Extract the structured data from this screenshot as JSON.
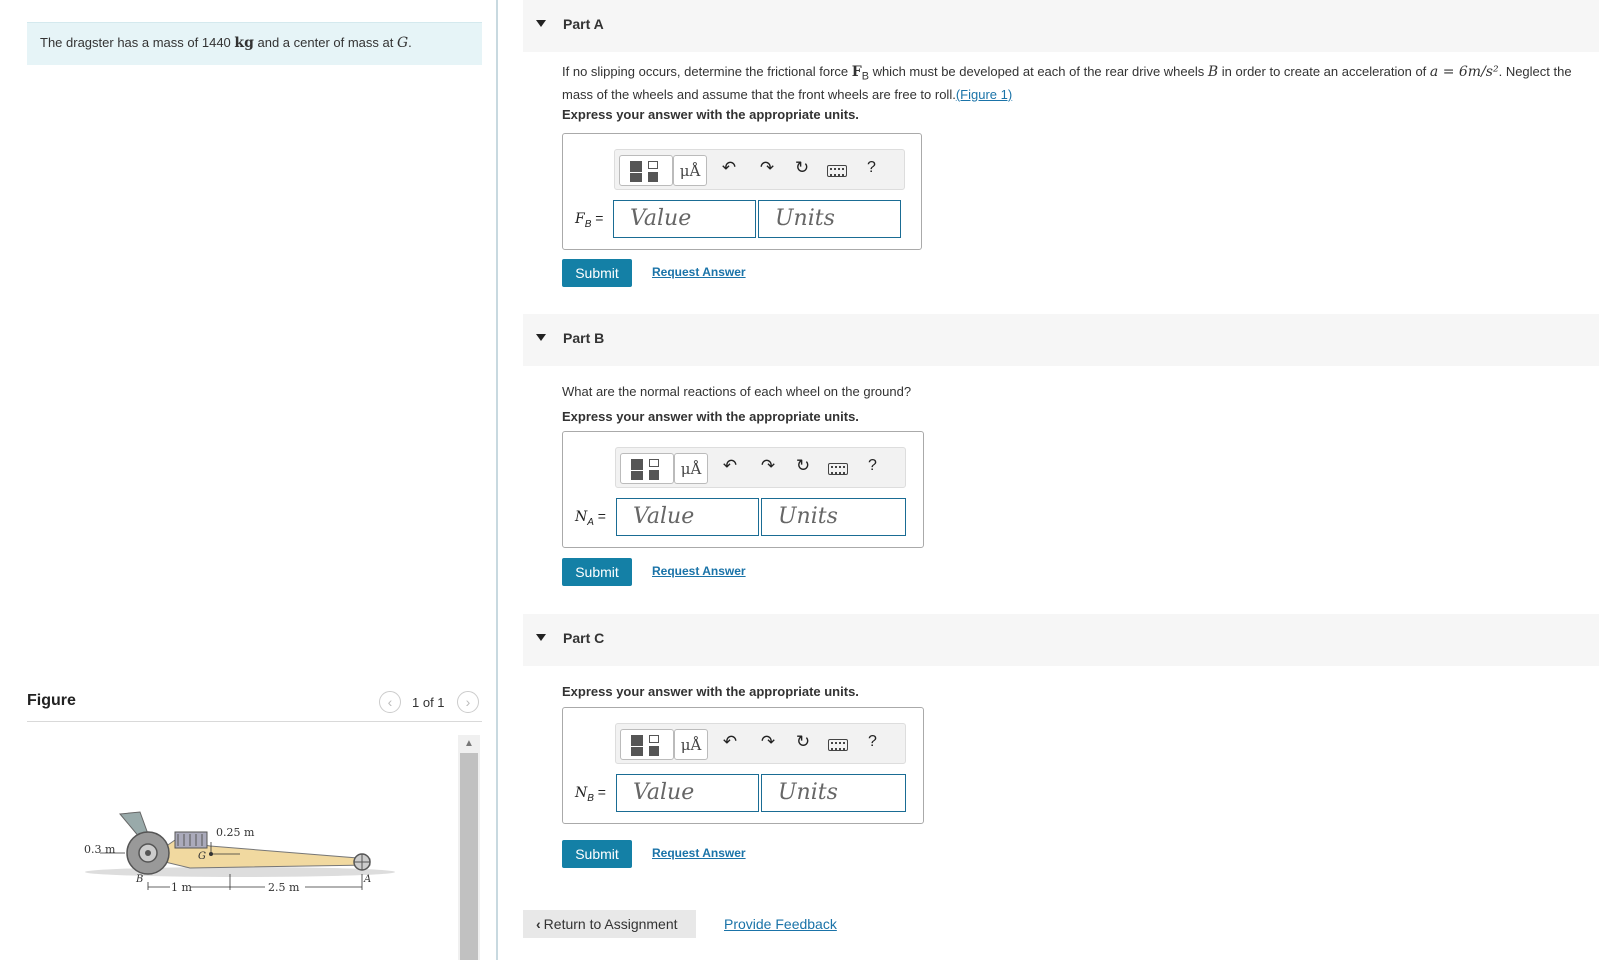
{
  "problem": {
    "text_before": "The dragster has a mass of 1440 ",
    "mass_unit": "kg",
    "text_after": " and a center of mass at ",
    "point": "G",
    "period": "."
  },
  "figure_panel": {
    "title": "Figure",
    "count": "1 of 1",
    "labels": {
      "dim_03": "0.3 m",
      "dim_025": "0.25 m",
      "dim_1": "1 m",
      "dim_25": "2.5 m",
      "pt_B": "B",
      "pt_G": "G",
      "pt_A": "A"
    }
  },
  "parts": [
    {
      "title": "Part A",
      "question_1": "If no slipping occurs, determine the frictional force ",
      "var_F": "F",
      "var_F_sub": "B",
      "question_2": " which must be developed at each of the rear drive wheels ",
      "var_B": "B",
      "question_3": " in order to create an acceleration of ",
      "accel": "a = 6m/s²",
      "question_4": ". Neglect the",
      "question_line2": "mass of the wheels and assume that the front wheels are free to roll.",
      "figure_link": "(Figure 1)",
      "figure_link_close": "",
      "express": "Express your answer with the appropriate units.",
      "label_var": "F",
      "label_sub": "B",
      "value_placeholder": "Value",
      "units_placeholder": "Units",
      "submit": "Submit",
      "request": "Request Answer"
    },
    {
      "title": "Part B",
      "question": "What are the normal reactions of each wheel on the ground?",
      "express": "Express your answer with the appropriate units.",
      "label_var": "N",
      "label_sub": "A",
      "value_placeholder": "Value",
      "units_placeholder": "Units",
      "submit": "Submit",
      "request": "Request Answer"
    },
    {
      "title": "Part C",
      "express": "Express your answer with the appropriate units.",
      "label_var": "N",
      "label_sub": "B",
      "value_placeholder": "Value",
      "units_placeholder": "Units",
      "submit": "Submit",
      "request": "Request Answer"
    }
  ],
  "toolbar": {
    "mu_label": "μÅ",
    "help": "?",
    "undo_icon": "undo-icon",
    "redo_icon": "redo-icon",
    "reset_icon": "reset-icon",
    "keyboard_icon": "keyboard-icon"
  },
  "footer": {
    "return": "Return to Assignment",
    "feedback": "Provide Feedback"
  },
  "colors": {
    "submit_bg": "#1480a6",
    "link": "#1a73a8",
    "problem_bg": "#e6f4f7",
    "input_border": "#1a6c94"
  }
}
